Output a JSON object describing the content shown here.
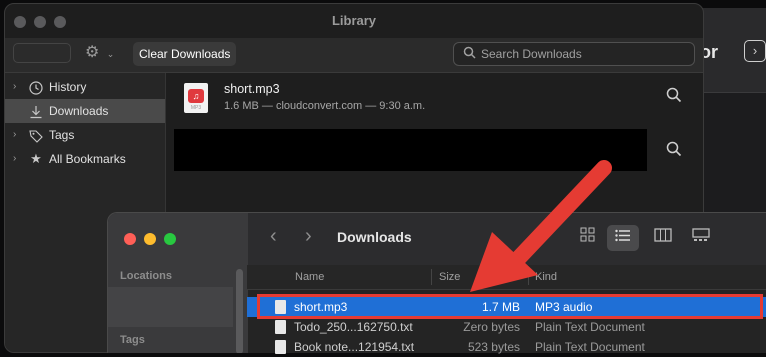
{
  "library": {
    "title": "Library",
    "toolbar": {
      "clear_label": "Clear Downloads",
      "search_placeholder": "Search Downloads"
    },
    "sidebar": {
      "items": [
        {
          "label": "History",
          "icon": "clock-icon",
          "expandable": true
        },
        {
          "label": "Downloads",
          "icon": "download-icon",
          "selected": true
        },
        {
          "label": "Tags",
          "icon": "tag-icon",
          "expandable": true
        },
        {
          "label": "All Bookmarks",
          "icon": "star-icon",
          "expandable": true
        }
      ]
    },
    "downloads": [
      {
        "name": "short.mp3",
        "meta": "1.6 MB — cloudconvert.com — 9:30 a.m.",
        "icon_label": "MP3"
      }
    ]
  },
  "background_window": {
    "partial_text": "or"
  },
  "finder": {
    "title": "Downloads",
    "sidebar": {
      "locations": "Locations",
      "tags": "Tags"
    },
    "columns": {
      "name": "Name",
      "size": "Size",
      "kind": "Kind"
    },
    "rows": [
      {
        "name": "short.mp3",
        "size": "1.7 MB",
        "kind": "MP3 audio",
        "selected": true
      },
      {
        "name": "Todo_250...162750.txt",
        "size": "Zero bytes",
        "kind": "Plain Text Document"
      },
      {
        "name": "Book note...121954.txt",
        "size": "523 bytes",
        "kind": "Plain Text Document"
      }
    ]
  },
  "colors": {
    "selection": "#1f6fd6",
    "annotation": "#e53b33"
  }
}
